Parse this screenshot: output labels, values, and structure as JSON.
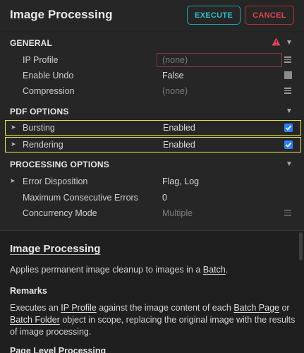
{
  "header": {
    "title": "Image Processing",
    "execute_label": "EXECUTE",
    "cancel_label": "CANCEL"
  },
  "sections": {
    "general": {
      "title": "GENERAL",
      "ip_profile": {
        "label": "IP Profile",
        "placeholder": "(none)"
      },
      "enable_undo": {
        "label": "Enable Undo",
        "value": "False"
      },
      "compression": {
        "label": "Compression",
        "value": "(none)"
      }
    },
    "pdf_options": {
      "title": "PDF OPTIONS",
      "bursting": {
        "label": "Bursting",
        "value": "Enabled",
        "checked": true
      },
      "rendering": {
        "label": "Rendering",
        "value": "Enabled",
        "checked": true
      }
    },
    "processing_options": {
      "title": "PROCESSING OPTIONS",
      "error_disposition": {
        "label": "Error Disposition",
        "value": "Flag, Log"
      },
      "max_errors": {
        "label": "Maximum Consecutive Errors",
        "value": "0"
      },
      "concurrency": {
        "label": "Concurrency Mode",
        "value": "Multiple"
      }
    }
  },
  "help": {
    "title": "Image Processing",
    "intro_text": "Applies permanent image cleanup to images in a ",
    "intro_link": "Batch",
    "intro_end": ".",
    "remarks_title": "Remarks",
    "remarks_1": "Executes an ",
    "remarks_link_1": "IP Profile",
    "remarks_2": " against the image content of each ",
    "remarks_link_2": "Batch Page",
    "remarks_3": " or ",
    "remarks_link_3": "Batch Folder",
    "remarks_4": " object in scope, replacing the original image with the results of image processing.",
    "next_title": "Page Level Processing"
  },
  "colors": {
    "execute": "#2cc2cd",
    "cancel": "#e0464f",
    "warning": "#e8455a",
    "selection": "#e8e84a",
    "checkbox": "#2d7ff9"
  },
  "icons": [
    "warning-icon",
    "chevron-down-icon",
    "menu-icon",
    "chevron-right-icon",
    "checkbox-icon"
  ]
}
